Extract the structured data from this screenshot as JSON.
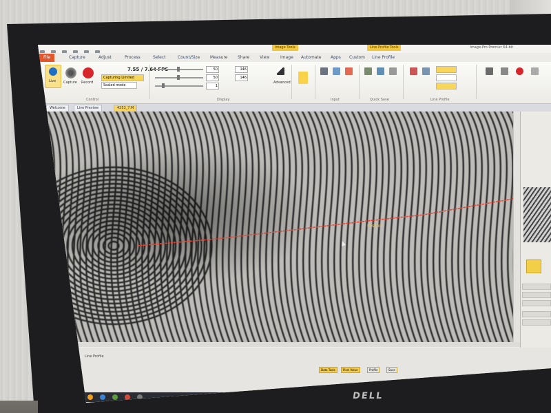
{
  "window": {
    "title": "Image-Pro Premier 64-bit",
    "context_tab_1": "Image Tools",
    "context_tab_2": "Line Profile Tools"
  },
  "ribbon_tabs": {
    "file": "File",
    "items": [
      "Capture",
      "Adjust",
      "Process",
      "Select",
      "Count/Size",
      "Measure",
      "Share",
      "View",
      "Image",
      "Automate",
      "Apps",
      "Custom",
      "Line Profile"
    ]
  },
  "capture_group": {
    "live": "Live",
    "capture": "Capture",
    "record": "Record",
    "fps": "7.55 / 7.64 FPS",
    "camera_dropdown": "Capturing Limited",
    "resolution_dropdown": "Scaled mode",
    "group_label": "Control"
  },
  "display_group": {
    "values": [
      "50",
      "50",
      "1"
    ],
    "gamma_values": [
      "146",
      "146"
    ],
    "label": "Display",
    "advanced": "Advanced"
  },
  "ribbon_groups": [
    "Input",
    "Quick Save",
    "Line Profile"
  ],
  "doc_tabs": [
    "Welcome",
    "Live Preview",
    "4253_7.M"
  ],
  "line_profile": {
    "annotation": "Position"
  },
  "bottom_panel": {
    "header": "Line Profile",
    "buttons": [
      "Data Tools",
      "Pixel Value",
      "Profile",
      "Save"
    ]
  },
  "brand": {
    "logo": "DELL"
  },
  "colors": {
    "accent": "#f2c740",
    "file_tab": "#e2572b",
    "profile_line": "#e04a3a",
    "record": "#d7262c"
  }
}
